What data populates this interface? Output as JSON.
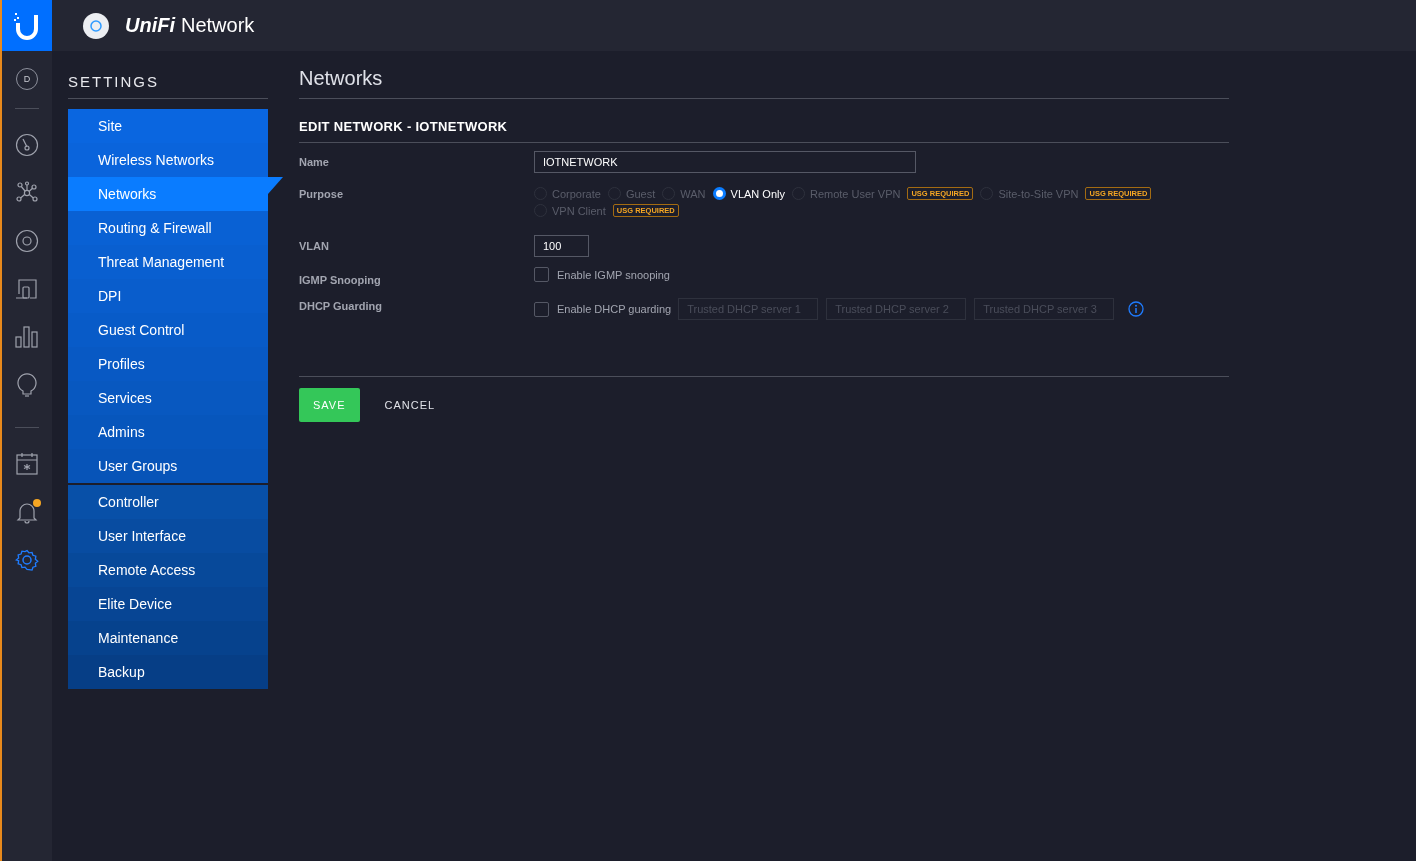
{
  "app": {
    "brand_italic": "UniFi",
    "brand_name": "Network"
  },
  "rail": {
    "site_initial": "D",
    "items": [
      {
        "kind": "dashboard",
        "selected": false
      },
      {
        "kind": "topology",
        "selected": false
      },
      {
        "kind": "devices",
        "selected": false
      },
      {
        "kind": "clients",
        "selected": false
      },
      {
        "kind": "statistics",
        "selected": false
      },
      {
        "kind": "insights",
        "selected": false
      },
      {
        "kind": "divider"
      },
      {
        "kind": "events",
        "selected": false
      },
      {
        "kind": "alerts",
        "selected": false,
        "alert": true
      },
      {
        "kind": "settings",
        "selected": true
      }
    ]
  },
  "settings_menu": {
    "title": "SETTINGS",
    "groups": [
      [
        {
          "label": "Site",
          "selected": false
        },
        {
          "label": "Wireless Networks",
          "selected": false
        },
        {
          "label": "Networks",
          "selected": true
        },
        {
          "label": "Routing & Firewall",
          "selected": false
        },
        {
          "label": "Threat Management",
          "selected": false
        },
        {
          "label": "DPI",
          "selected": false
        },
        {
          "label": "Guest Control",
          "selected": false
        },
        {
          "label": "Profiles",
          "selected": false
        },
        {
          "label": "Services",
          "selected": false
        },
        {
          "label": "Admins",
          "selected": false
        },
        {
          "label": "User Groups",
          "selected": false
        }
      ],
      [
        {
          "label": "Controller",
          "selected": false
        },
        {
          "label": "User Interface",
          "selected": false
        },
        {
          "label": "Remote Access",
          "selected": false
        },
        {
          "label": "Elite Device",
          "selected": false
        },
        {
          "label": "Maintenance",
          "selected": false
        },
        {
          "label": "Backup",
          "selected": false
        }
      ]
    ]
  },
  "page_title": "Networks",
  "form": {
    "heading": "EDIT NETWORK - IOTNETWORK",
    "name": {
      "label": "Name",
      "value": "IOTNETWORK"
    },
    "purpose": {
      "label": "Purpose",
      "options": [
        {
          "label": "Corporate",
          "selected": false,
          "disabled": true
        },
        {
          "label": "Guest",
          "selected": false,
          "disabled": true
        },
        {
          "label": "WAN",
          "selected": false,
          "disabled": true
        },
        {
          "label": "VLAN Only",
          "selected": true,
          "disabled": false
        },
        {
          "label": "Remote User VPN",
          "selected": false,
          "disabled": true,
          "badge": "USG REQUIRED"
        },
        {
          "label": "Site-to-Site VPN",
          "selected": false,
          "disabled": true,
          "badge": "USG REQUIRED"
        },
        {
          "label": "VPN Client",
          "selected": false,
          "disabled": true,
          "badge": "USG REQUIRED"
        }
      ]
    },
    "vlan": {
      "label": "VLAN",
      "value": "100"
    },
    "igmp": {
      "label": "IGMP Snooping",
      "checkbox_label": "Enable IGMP snooping",
      "checked": false
    },
    "dhcp": {
      "label": "DHCP Guarding",
      "checkbox_label": "Enable DHCP guarding",
      "checked": false,
      "servers": [
        {
          "placeholder": "Trusted DHCP server 1"
        },
        {
          "placeholder": "Trusted DHCP server 2"
        },
        {
          "placeholder": "Trusted DHCP server 3"
        }
      ]
    },
    "save": "SAVE",
    "cancel": "CANCEL"
  }
}
